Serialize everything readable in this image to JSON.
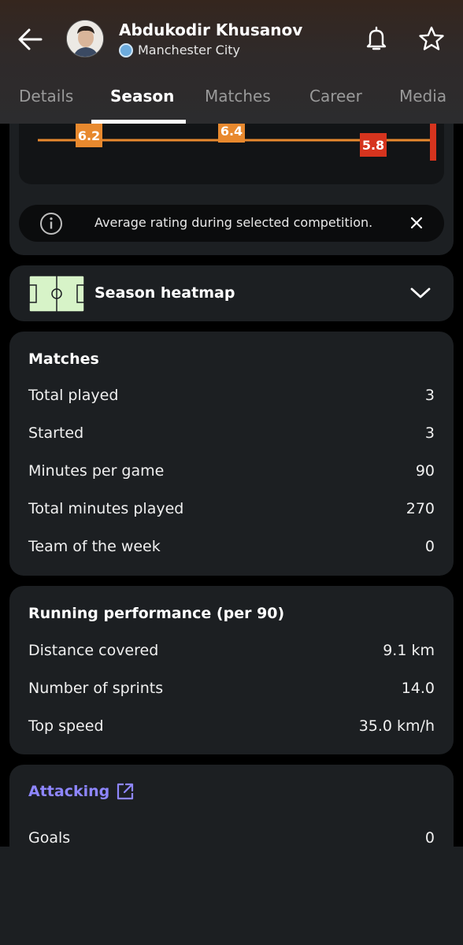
{
  "header": {
    "player_name": "Abdukodir Khusanov",
    "club_name": "Manchester City",
    "icons": {
      "back": "back-arrow-icon",
      "bell": "bell-icon",
      "star": "star-icon"
    }
  },
  "tabs": [
    {
      "label": "Details"
    },
    {
      "label": "Season",
      "active": true
    },
    {
      "label": "Matches"
    },
    {
      "label": "Career"
    },
    {
      "label": "Media"
    }
  ],
  "rating_chart": {
    "chart_data": {
      "type": "line",
      "values": [
        6.2,
        6.4,
        5.8
      ],
      "labels": [
        "6.2",
        "6.4",
        "5.8"
      ]
    },
    "colors": {
      "line": "#e8892e",
      "orange": "#e8892e",
      "red": "#d6341e",
      "scale_top": "#f1c232"
    }
  },
  "info": {
    "text": "Average rating during selected competition."
  },
  "heatmap": {
    "title": "Season heatmap"
  },
  "matches": {
    "title": "Matches",
    "rows": [
      {
        "label": "Total played",
        "value": "3"
      },
      {
        "label": "Started",
        "value": "3"
      },
      {
        "label": "Minutes per game",
        "value": "90"
      },
      {
        "label": "Total minutes played",
        "value": "270"
      },
      {
        "label": "Team of the week",
        "value": "0"
      }
    ]
  },
  "running": {
    "title": "Running performance (per 90)",
    "rows": [
      {
        "label": "Distance covered",
        "value": "9.1 km"
      },
      {
        "label": "Number of sprints",
        "value": "14.0"
      },
      {
        "label": "Top speed",
        "value": "35.0 km/h"
      }
    ]
  },
  "attacking": {
    "title": "Attacking",
    "rows": [
      {
        "label": "Goals",
        "value": "0"
      }
    ],
    "accent": "#8e86ff"
  }
}
